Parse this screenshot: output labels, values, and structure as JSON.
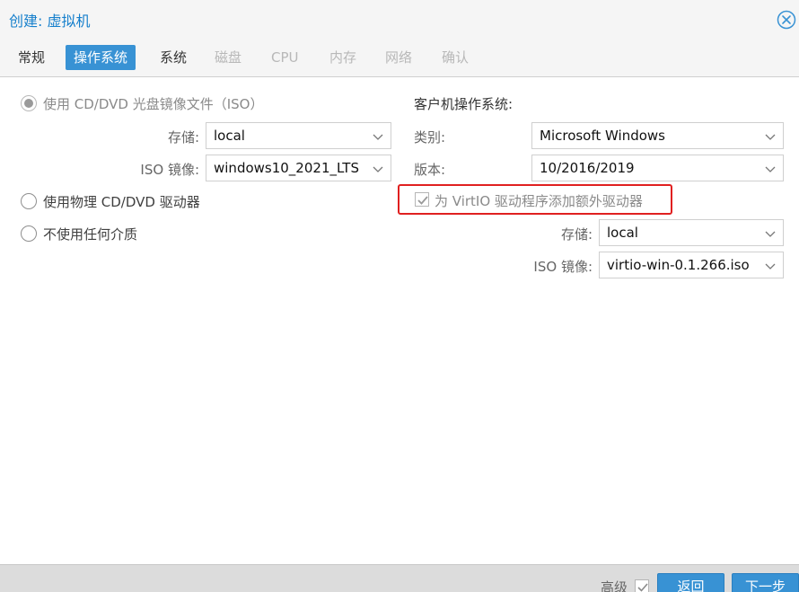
{
  "dialog": {
    "title": "创建: 虚拟机",
    "close_icon": "close-circle-icon"
  },
  "tabs": [
    {
      "label": "常规",
      "state": "normal"
    },
    {
      "label": "操作系统",
      "state": "active"
    },
    {
      "label": "系统",
      "state": "normal"
    },
    {
      "label": "磁盘",
      "state": "disabled"
    },
    {
      "label": "CPU",
      "state": "disabled"
    },
    {
      "label": "内存",
      "state": "disabled"
    },
    {
      "label": "网络",
      "state": "disabled"
    },
    {
      "label": "确认",
      "state": "disabled"
    }
  ],
  "media": {
    "option_iso": "使用 CD/DVD 光盘镜像文件（ISO）",
    "storage_label": "存储:",
    "storage_value": "local",
    "iso_label": "ISO 镜像:",
    "iso_value": "windows10_2021_LTS",
    "option_physical": "使用物理 CD/DVD 驱动器",
    "option_none": "不使用任何介质",
    "selected": "iso"
  },
  "guest_os": {
    "heading": "客户机操作系统:",
    "type_label": "类别:",
    "type_value": "Microsoft Windows",
    "version_label": "版本:",
    "version_value": "10/2016/2019",
    "virtio_label": "为 VirtIO 驱动程序添加额外驱动器",
    "virtio_checked": true,
    "virtio_storage_label": "存储:",
    "virtio_storage_value": "local",
    "virtio_iso_label": "ISO 镜像:",
    "virtio_iso_value": "virtio-win-0.1.266.iso"
  },
  "footer": {
    "advanced_label": "高级",
    "advanced_checked": true,
    "back_label": "返回",
    "next_label": "下一步"
  },
  "colors": {
    "accent": "#3892d4",
    "title": "#157fcc",
    "highlight": "#e02020"
  }
}
